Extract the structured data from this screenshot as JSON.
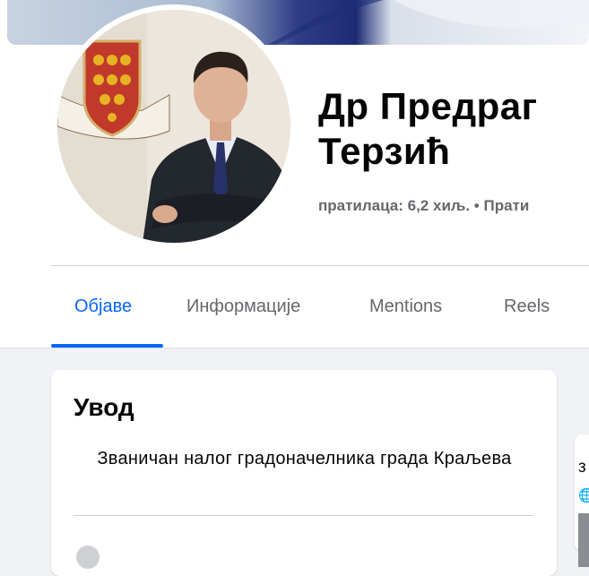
{
  "profile": {
    "name": "Др Предраг\nТерзић",
    "followers_line": "пратилаца: 6,2 хиљ. • Прати"
  },
  "tabs": [
    {
      "label": "Објаве",
      "active": true
    },
    {
      "label": "Информације",
      "active": false
    },
    {
      "label": "Mentions",
      "active": false
    },
    {
      "label": "Reels",
      "active": false
    }
  ],
  "intro": {
    "title": "Увод",
    "bio": "Званичан налог градоначелника града Краљева"
  },
  "side_card": {
    "snippet": "з",
    "globe_icon": "globe-icon"
  },
  "colors": {
    "accent": "#0866ff",
    "secondary_text": "#65676b",
    "background": "#f0f2f5"
  },
  "icons": {
    "coat_of_arms": "coat-of-arms-icon"
  }
}
